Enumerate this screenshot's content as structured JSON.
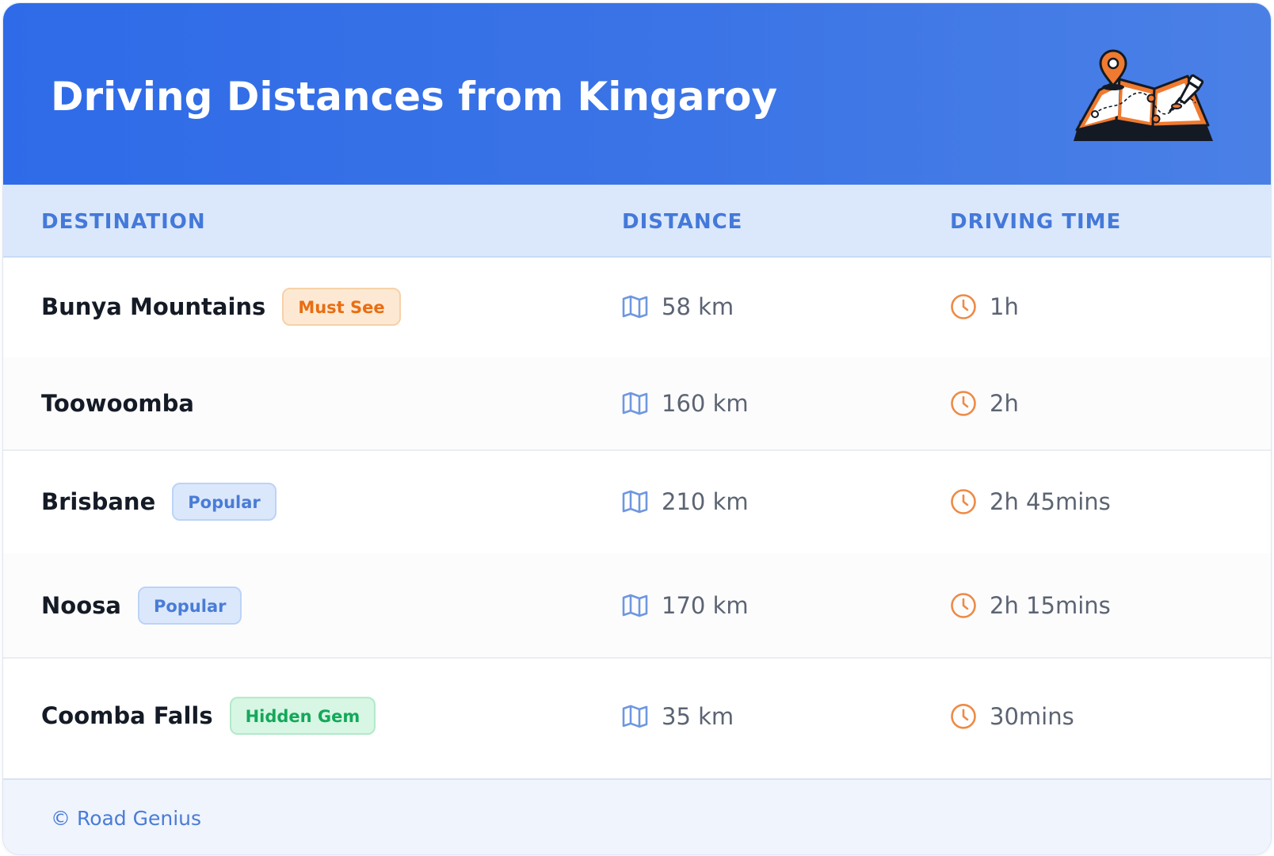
{
  "header": {
    "title": "Driving Distances from Kingaroy",
    "illustration_icon": "map-with-pins-icon"
  },
  "columns": {
    "destination": "DESTINATION",
    "distance": "DISTANCE",
    "driving_time": "DRIVING TIME"
  },
  "rows": [
    {
      "name": "Bunya Mountains",
      "badge": "Must See",
      "distance": "58 km",
      "time": "1h"
    },
    {
      "name": "Toowoomba",
      "badge": "",
      "distance": "160 km",
      "time": "2h"
    },
    {
      "name": "Brisbane",
      "badge": "Popular",
      "distance": "210 km",
      "time": "2h 45mins"
    },
    {
      "name": "Noosa",
      "badge": "Popular",
      "distance": "170 km",
      "time": "2h 15mins"
    },
    {
      "name": "Coomba Falls",
      "badge": "Hidden Gem",
      "distance": "35 km",
      "time": "30mins"
    }
  ],
  "icons": {
    "distance": "map-icon",
    "time": "clock-icon"
  },
  "colors": {
    "header_gradient_start": "#2f6be8",
    "header_gradient_end": "#4a80e6",
    "column_header_bg": "#dbe8fb",
    "column_header_text": "#4479d9",
    "badge_must_see": "#ea6d12",
    "badge_popular": "#4a7cd6",
    "badge_hidden_gem": "#14a85a",
    "clock_icon": "#ee8a45",
    "map_icon": "#6f97e0"
  },
  "footer": {
    "copyright": "© Road Genius"
  }
}
